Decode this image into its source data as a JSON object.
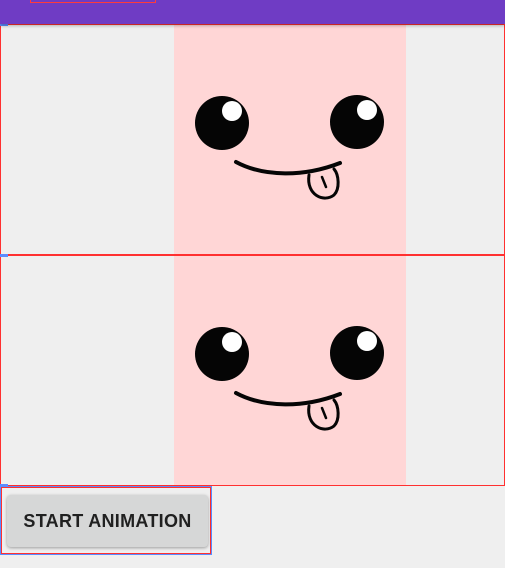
{
  "app": {
    "toolbar_color": "#6f3cc4"
  },
  "panels": [
    {
      "name": "top-animation-panel",
      "image": "smiley-face-tongue-icon",
      "background": "#ffd6d6"
    },
    {
      "name": "bottom-animation-panel",
      "image": "smiley-face-tongue-icon",
      "background": "#ffd6d6"
    }
  ],
  "controls": {
    "start_label": "START ANIMATION"
  }
}
